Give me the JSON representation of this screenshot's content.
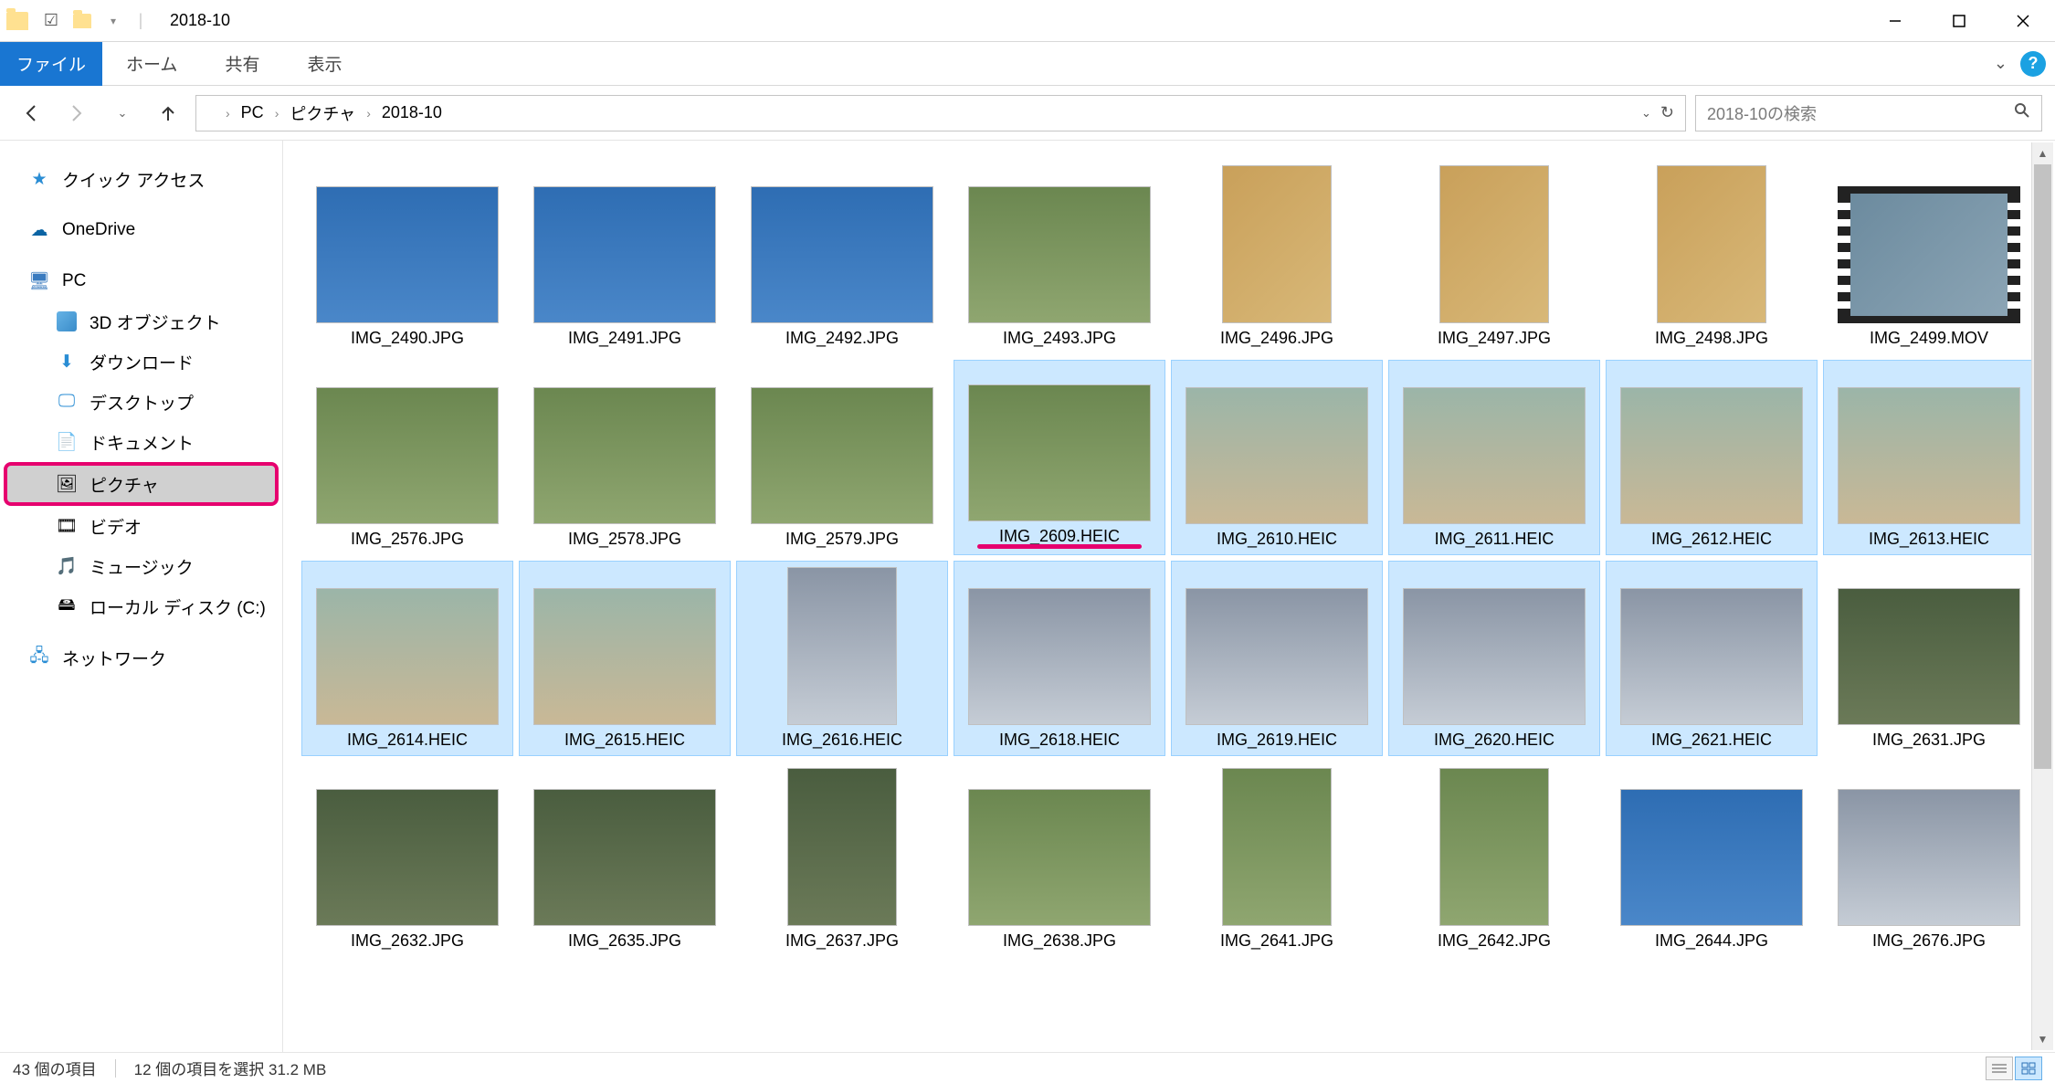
{
  "window": {
    "title": "2018-10"
  },
  "ribbon": {
    "file": "ファイル",
    "tabs": [
      "ホーム",
      "共有",
      "表示"
    ]
  },
  "address": {
    "crumbs": [
      "PC",
      "ピクチャ",
      "2018-10"
    ],
    "refresh_aria": "最新の情報に更新"
  },
  "search": {
    "placeholder": "2018-10の検索"
  },
  "nav": {
    "quick_access": "クイック アクセス",
    "onedrive": "OneDrive",
    "pc": "PC",
    "pc_children": [
      "3D オブジェクト",
      "ダウンロード",
      "デスクトップ",
      "ドキュメント",
      "ピクチャ",
      "ビデオ",
      "ミュージック",
      "ローカル ディスク (C:)"
    ],
    "network": "ネットワーク"
  },
  "files": [
    {
      "name": "IMG_2490.JPG",
      "cls": "sky",
      "sel": false,
      "portrait": false,
      "video": false
    },
    {
      "name": "IMG_2491.JPG",
      "cls": "sky",
      "sel": false,
      "portrait": false,
      "video": false
    },
    {
      "name": "IMG_2492.JPG",
      "cls": "sky",
      "sel": false,
      "portrait": false,
      "video": false
    },
    {
      "name": "IMG_2493.JPG",
      "cls": "park",
      "sel": false,
      "portrait": false,
      "video": false
    },
    {
      "name": "IMG_2496.JPG",
      "cls": "food",
      "sel": false,
      "portrait": true,
      "video": false
    },
    {
      "name": "IMG_2497.JPG",
      "cls": "food",
      "sel": false,
      "portrait": true,
      "video": false
    },
    {
      "name": "IMG_2498.JPG",
      "cls": "food",
      "sel": false,
      "portrait": true,
      "video": false
    },
    {
      "name": "IMG_2499.MOV",
      "cls": "",
      "sel": false,
      "portrait": false,
      "video": true
    },
    {
      "name": "IMG_2576.JPG",
      "cls": "park",
      "sel": false,
      "portrait": false,
      "video": false
    },
    {
      "name": "IMG_2578.JPG",
      "cls": "park",
      "sel": false,
      "portrait": false,
      "video": false
    },
    {
      "name": "IMG_2579.JPG",
      "cls": "park",
      "sel": false,
      "portrait": false,
      "video": false
    },
    {
      "name": "IMG_2609.HEIC",
      "cls": "park",
      "sel": true,
      "portrait": false,
      "video": false,
      "underline": true
    },
    {
      "name": "IMG_2610.HEIC",
      "cls": "shrine",
      "sel": true,
      "portrait": false,
      "video": false
    },
    {
      "name": "IMG_2611.HEIC",
      "cls": "shrine",
      "sel": true,
      "portrait": false,
      "video": false
    },
    {
      "name": "IMG_2612.HEIC",
      "cls": "shrine",
      "sel": true,
      "portrait": false,
      "video": false
    },
    {
      "name": "IMG_2613.HEIC",
      "cls": "shrine",
      "sel": true,
      "portrait": false,
      "video": false
    },
    {
      "name": "IMG_2614.HEIC",
      "cls": "shrine",
      "sel": true,
      "portrait": false,
      "video": false
    },
    {
      "name": "IMG_2615.HEIC",
      "cls": "shrine",
      "sel": true,
      "portrait": false,
      "video": false
    },
    {
      "name": "IMG_2616.HEIC",
      "cls": "city",
      "sel": true,
      "portrait": true,
      "video": false
    },
    {
      "name": "IMG_2618.HEIC",
      "cls": "city",
      "sel": true,
      "portrait": false,
      "video": false
    },
    {
      "name": "IMG_2619.HEIC",
      "cls": "city",
      "sel": true,
      "portrait": false,
      "video": false
    },
    {
      "name": "IMG_2620.HEIC",
      "cls": "city",
      "sel": true,
      "portrait": false,
      "video": false
    },
    {
      "name": "IMG_2621.HEIC",
      "cls": "city",
      "sel": true,
      "portrait": false,
      "video": false
    },
    {
      "name": "IMG_2631.JPG",
      "cls": "garden",
      "sel": false,
      "portrait": false,
      "video": false
    },
    {
      "name": "IMG_2632.JPG",
      "cls": "garden",
      "sel": false,
      "portrait": false,
      "video": false
    },
    {
      "name": "IMG_2635.JPG",
      "cls": "garden",
      "sel": false,
      "portrait": false,
      "video": false
    },
    {
      "name": "IMG_2637.JPG",
      "cls": "garden",
      "sel": false,
      "portrait": true,
      "video": false
    },
    {
      "name": "IMG_2638.JPG",
      "cls": "park",
      "sel": false,
      "portrait": false,
      "video": false
    },
    {
      "name": "IMG_2641.JPG",
      "cls": "park",
      "sel": false,
      "portrait": true,
      "video": false
    },
    {
      "name": "IMG_2642.JPG",
      "cls": "park",
      "sel": false,
      "portrait": true,
      "video": false
    },
    {
      "name": "IMG_2644.JPG",
      "cls": "sky",
      "sel": false,
      "portrait": false,
      "video": false
    },
    {
      "name": "IMG_2676.JPG",
      "cls": "city",
      "sel": false,
      "portrait": false,
      "video": false
    }
  ],
  "status": {
    "count": "43 個の項目",
    "selection": "12 個の項目を選択 31.2 MB"
  }
}
